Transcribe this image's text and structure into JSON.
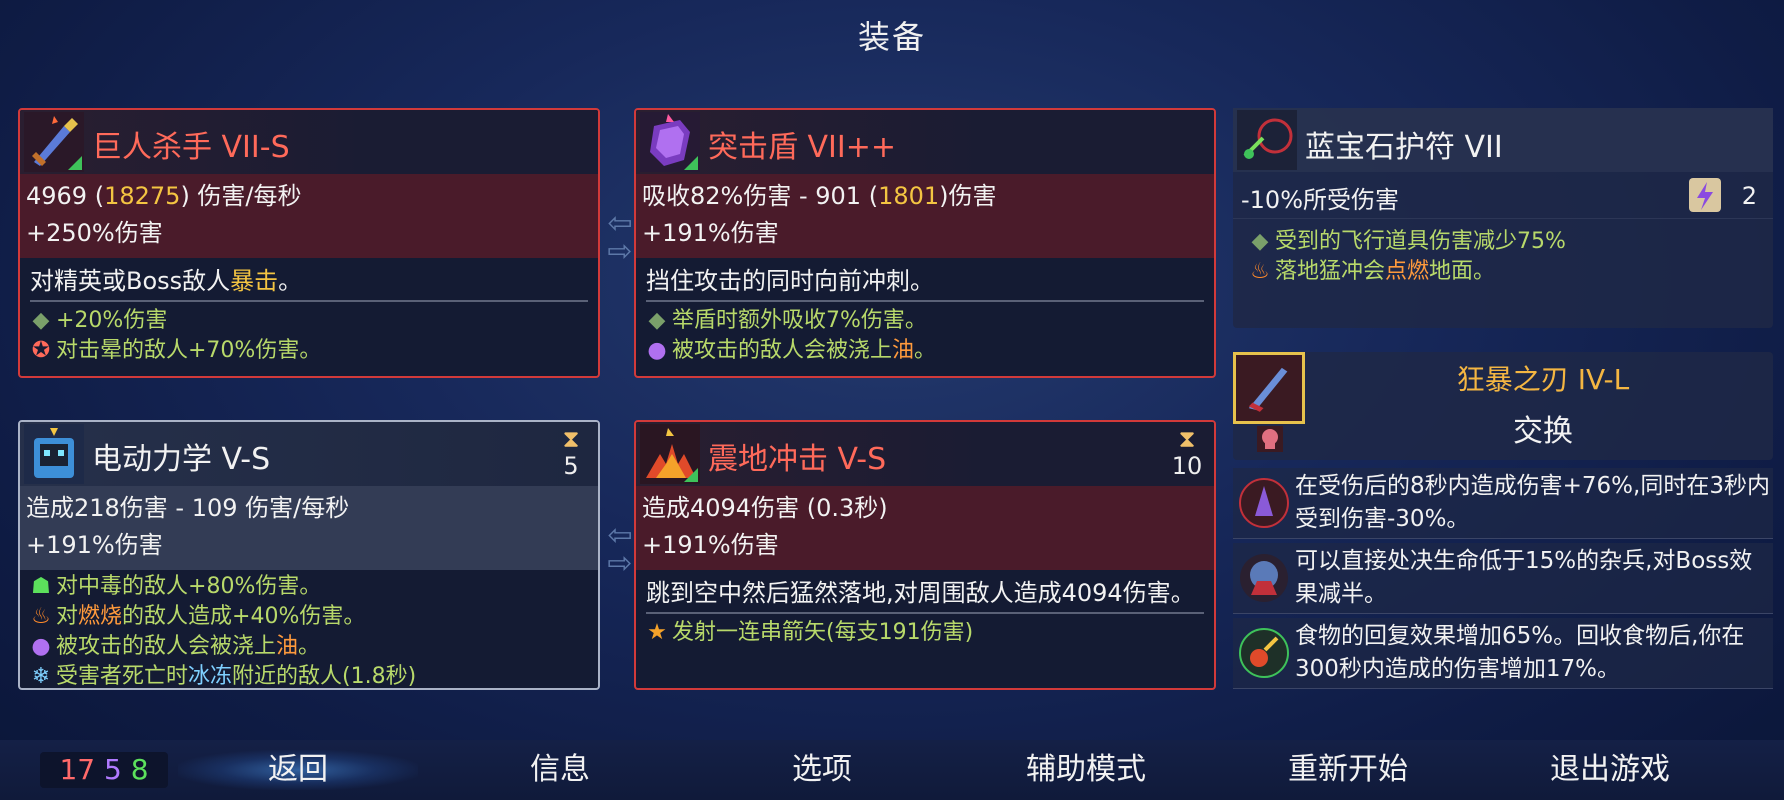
{
  "title": "装备",
  "cards": [
    {
      "name": "巨人杀手 VII-S",
      "stat1_a": "4969 (",
      "stat1_b": "18275",
      "stat1_c": ") 伤害/每秒",
      "stat2": "+250%伤害",
      "desc_a": "对精英或Boss敌人",
      "desc_b": "暴击",
      "desc_c": "。",
      "traits": [
        {
          "icon": "diamond-bullet",
          "text": "+20%伤害"
        },
        {
          "icon": "stun-icon",
          "text": "对击晕的敌人+70%伤害。"
        }
      ]
    },
    {
      "name": "突击盾 VII++",
      "stat1_a": "吸收82%伤害 - 901 (",
      "stat1_b": "1801",
      "stat1_c": ")伤害",
      "stat2": "+191%伤害",
      "desc": "挡住攻击的同时向前冲刺。",
      "traits": [
        {
          "icon": "diamond-bullet",
          "text": "举盾时额外吸收7%伤害。"
        },
        {
          "icon": "oil-icon",
          "text_a": "被攻击的敌人会被浇上",
          "text_b": "油",
          "text_c": "。"
        }
      ]
    },
    {
      "name": "电动力学 V-S",
      "cooldown": "5",
      "stat1": "造成218伤害 - 109 伤害/每秒",
      "stat2": "+191%伤害",
      "traits": [
        {
          "icon": "poison-icon",
          "text_a": "对",
          "text_b": "中毒",
          "text_c": "的敌人+80%伤害。"
        },
        {
          "icon": "fire-icon",
          "text_a": "对",
          "text_b": "燃烧",
          "text_c": "的敌人造成+40%伤害。"
        },
        {
          "icon": "oil-icon",
          "text_a": "被攻击的敌人会被浇上",
          "text_b": "油",
          "text_c": "。"
        },
        {
          "icon": "freeze-icon",
          "text_a": "受害者死亡时",
          "text_b": "冰冻",
          "text_c": "附近的敌人(1.8秒)"
        }
      ]
    },
    {
      "name": "震地冲击 V-S",
      "cooldown": "10",
      "stat1": "造成4094伤害 (0.3秒)",
      "stat2": "+191%伤害",
      "desc": "跳到空中然后猛然落地,对周围敌人造成4094伤害。",
      "traits": [
        {
          "icon": "star-icon",
          "text": "发射一连串箭矢(每支191伤害)"
        }
      ]
    }
  ],
  "amulet": {
    "name": "蓝宝石护符 VII",
    "stat": "-10%所受伤害",
    "scroll_count": "2",
    "traits": [
      {
        "icon": "diamond-bullet",
        "text": "受到的飞行道具伤害减少75%"
      },
      {
        "icon": "fire-icon",
        "text_a": "落地猛冲会",
        "text_b": "点燃",
        "text_c": "地面。"
      }
    ]
  },
  "mutation": {
    "name": "狂暴之刃 IV-L",
    "swap": "交换",
    "rows": [
      {
        "icon": "rage-mutation-icon",
        "text": "在受伤后的8秒内造成伤害+76%,同时在3秒内受到伤害-30%。"
      },
      {
        "icon": "execute-mutation-icon",
        "text": "可以直接处决生命低于15%的杂兵,对Boss效果减半。"
      },
      {
        "icon": "food-mutation-icon",
        "text": "食物的回复效果增加65%。回收食物后,你在300秒内造成的伤害增加17%。"
      }
    ]
  },
  "scrolls": {
    "brutality": "17",
    "tactics": "5",
    "survival": "8"
  },
  "menu": [
    "返回",
    "信息",
    "选项",
    "辅助模式",
    "重新开始",
    "退出游戏"
  ]
}
